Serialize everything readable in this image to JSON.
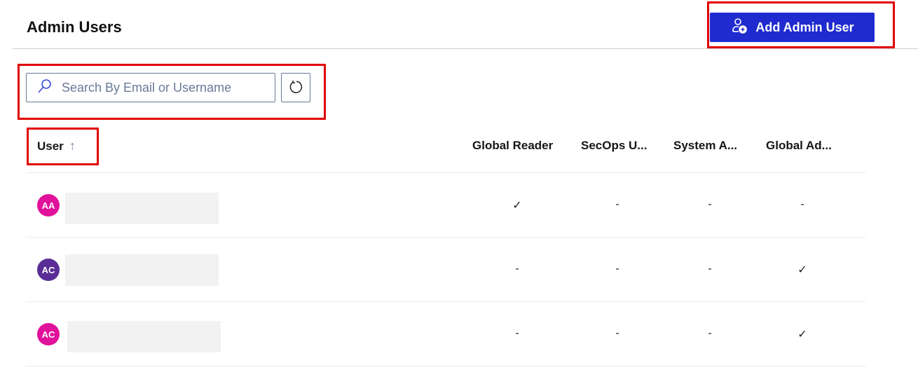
{
  "header": {
    "title": "Admin Users",
    "add_button_label": "Add Admin User",
    "add_button_icon": "user-add-icon",
    "accent_color": "#1f2bcf"
  },
  "search": {
    "placeholder": "Search By Email or Username",
    "value": "",
    "search_icon": "search-icon",
    "refresh_icon": "refresh-icon"
  },
  "table": {
    "columns": [
      {
        "label": "User",
        "sort": "ascending",
        "sort_icon": "arrow-up-icon"
      },
      {
        "label": "Global Reader"
      },
      {
        "label": "SecOps U..."
      },
      {
        "label": "System A..."
      },
      {
        "label": "Global Ad..."
      }
    ],
    "rows": [
      {
        "initials": "AA",
        "avatar_color": "#e0119a",
        "name": "",
        "cells": [
          "✓",
          "-",
          "-",
          "-"
        ]
      },
      {
        "initials": "AC",
        "avatar_color": "#5a2d96",
        "name": "",
        "cells": [
          "-",
          "-",
          "-",
          "✓"
        ]
      },
      {
        "initials": "AC",
        "avatar_color": "#e0119a",
        "name": "",
        "cells": [
          "-",
          "-",
          "-",
          "✓"
        ]
      }
    ]
  }
}
